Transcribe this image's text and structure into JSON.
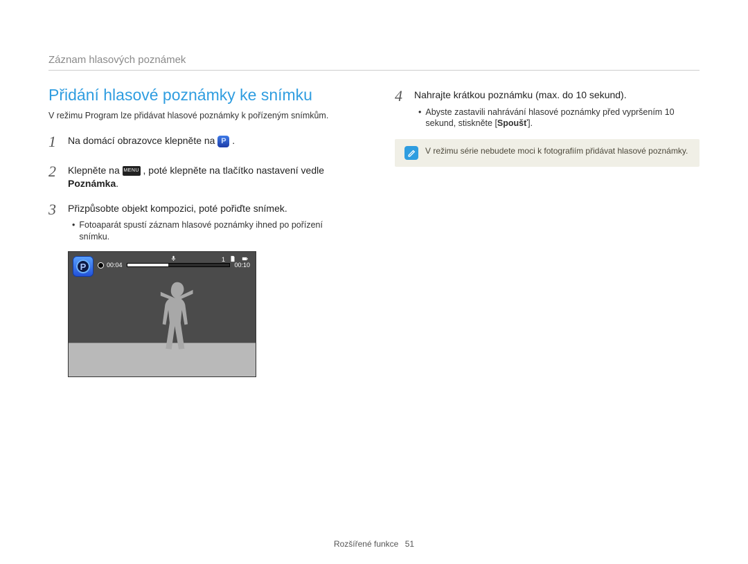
{
  "breadcrumb": "Záznam hlasových poznámek",
  "heading": "Přidání hlasové poznámky ke snímku",
  "intro": "V režimu Program lze přidávat hlasové poznámky k pořízeným snímkům.",
  "steps": {
    "1": {
      "pre": "Na domácí obrazovce klepněte na ",
      "post": "."
    },
    "2": {
      "pre": "Klepněte na ",
      "mid": ", poté klepněte na tlačítko nastavení vedle ",
      "bold": "Poznámka",
      "end": "."
    },
    "3": {
      "text": "Přizpůsobte objekt kompozici, poté pořiďte snímek.",
      "bullet": "Fotoaparát spustí záznam hlasové poznámky ihned po pořízení snímku."
    },
    "4": {
      "text": "Nahrajte krátkou poznámku (max. do 10 sekund).",
      "bullet_pre": "Abyste zastavili nahrávání hlasové poznámky před vypršením 10 sekund, stiskněte [",
      "bullet_bold": "Spoušť",
      "bullet_post": "]."
    }
  },
  "preview": {
    "elapsed": "00:04",
    "total": "00:10",
    "count": "1"
  },
  "icons": {
    "p_label": "P",
    "menu_label": "MENU"
  },
  "note": "V režimu série nebudete moci k fotografiím přidávat hlasové poznámky.",
  "footer": {
    "section": "Rozšířené funkce",
    "page": "51"
  }
}
